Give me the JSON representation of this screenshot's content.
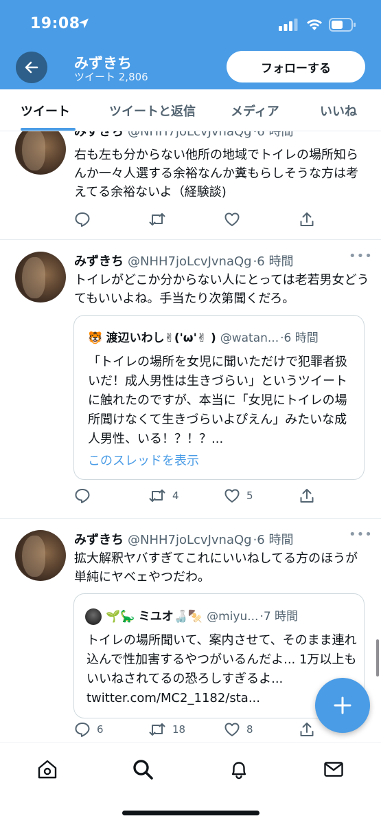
{
  "status_bar": {
    "time": "19:08"
  },
  "header": {
    "name": "みずきち",
    "tweet_count": "ツイート 2,806",
    "follow_label": "フォローする"
  },
  "tabs": [
    {
      "label": "ツイート",
      "active": true
    },
    {
      "label": "ツイートと返信",
      "active": false
    },
    {
      "label": "メディア",
      "active": false
    },
    {
      "label": "いいね",
      "active": false
    }
  ],
  "tweets": [
    {
      "name": "みずきち",
      "handle": "@NHH7joLcvJvnaQg",
      "time": "·6 時間",
      "text": "右も左も分からない他所の地域でトイレの場所知らんか一々人選する余裕なんか糞もらしそうな方は考えてる余裕ないよ（経験談)",
      "replies": "",
      "retweets": "",
      "likes": ""
    },
    {
      "name": "みずきち",
      "handle": "@NHH7joLcvJvnaQg",
      "time": "·6 時間",
      "text": "トイレがどこか分からない人にとっては老若男女どうてもいいよね。手当たり次第聞くだろ。",
      "quote": {
        "emoji": "🐯",
        "name": "渡辺いわし✌('ω'✌ )",
        "handle": "@watan...",
        "time": "·6 時間",
        "text": "「トイレの場所を女児に聞いただけで犯罪者扱いだ！成人男性は生きづらい」というツイートに触れたのですが、本当に「女児にトイレの場所聞けなくて生きづらいよぴえん」みたいな成人男性、いる！？！？...",
        "link": "このスレッドを表示"
      },
      "replies": "",
      "retweets": "4",
      "likes": "5"
    },
    {
      "name": "みずきち",
      "handle": "@NHH7joLcvJvnaQg",
      "time": "·6 時間",
      "text": "拡大解釈ヤバすぎてこれにいいねしてる方のほうが単純にヤベェやつだわ。",
      "quote": {
        "emoji": "🌱🦕",
        "name": "ミユオ🍶🍢",
        "handle": "@miyu...",
        "time": "·7 時間",
        "text": "トイレの場所聞いて、案内させて、そのまま連れ込んで性加害するやつがいるんだよ... 1万以上もいいねされてるの恐ろしすぎるよ... twitter.com/MC2_1182/sta..."
      },
      "replies": "6",
      "retweets": "18",
      "likes": "8"
    }
  ],
  "colors": {
    "brand": "#4a9ce6",
    "text": "#0f1419",
    "secondary": "#536471"
  }
}
